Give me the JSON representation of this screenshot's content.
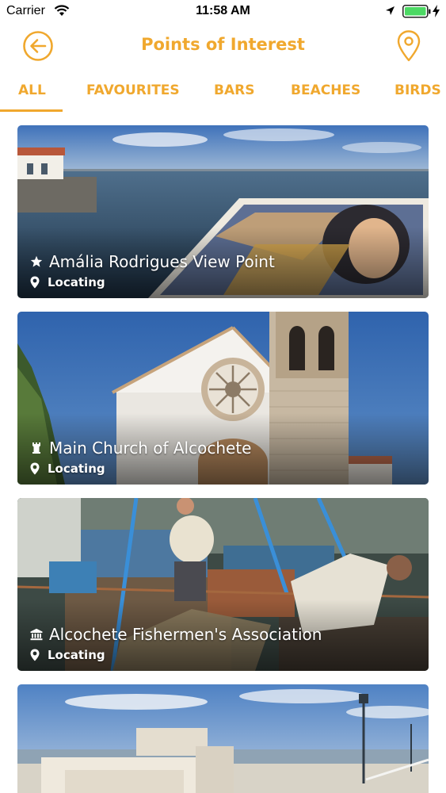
{
  "status_bar": {
    "carrier": "Carrier",
    "time": "11:58 AM",
    "icons": [
      "wifi-icon",
      "location-arrow-icon",
      "battery-icon",
      "charging-bolt-icon"
    ]
  },
  "header": {
    "title": "Points of Interest",
    "back_icon": "arrow-left-circle-icon",
    "map_icon": "map-pin-icon"
  },
  "tabs": [
    {
      "label": "ALL",
      "selected": true
    },
    {
      "label": "FAVOURITES",
      "selected": false
    },
    {
      "label": "BARS",
      "selected": false
    },
    {
      "label": "BEACHES",
      "selected": false
    },
    {
      "label": "BIRDS",
      "selected": false
    }
  ],
  "places": [
    {
      "name": "Amália Rodrigues View Point",
      "icon": "star-icon",
      "location": "Locating"
    },
    {
      "name": "Main Church of Alcochete",
      "icon": "tower-icon",
      "location": "Locating"
    },
    {
      "name": "Alcochete Fishermen's Association",
      "icon": "institution-icon",
      "location": "Locating"
    },
    {
      "name": "",
      "icon": "",
      "location": ""
    }
  ],
  "colors": {
    "accent": "#f0a82e",
    "battery": "#4cd964"
  }
}
